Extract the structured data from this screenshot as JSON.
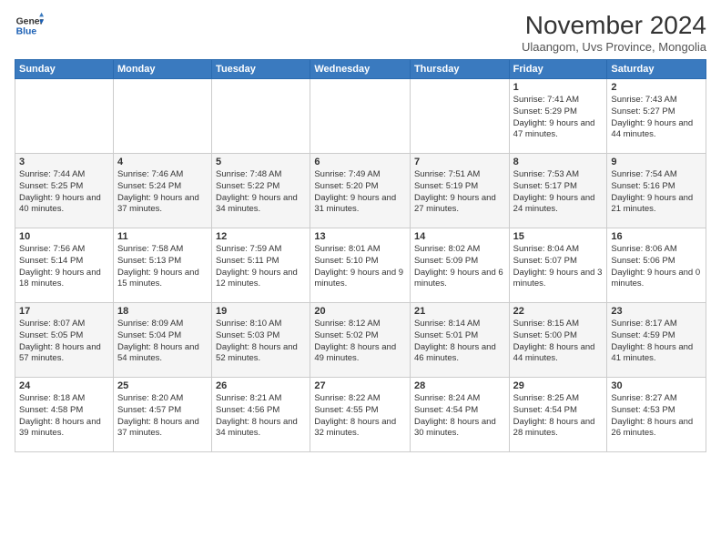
{
  "header": {
    "logo_line1": "General",
    "logo_line2": "Blue",
    "month_title": "November 2024",
    "location": "Ulaangom, Uvs Province, Mongolia"
  },
  "days_of_week": [
    "Sunday",
    "Monday",
    "Tuesday",
    "Wednesday",
    "Thursday",
    "Friday",
    "Saturday"
  ],
  "weeks": [
    [
      {
        "day": "",
        "info": ""
      },
      {
        "day": "",
        "info": ""
      },
      {
        "day": "",
        "info": ""
      },
      {
        "day": "",
        "info": ""
      },
      {
        "day": "",
        "info": ""
      },
      {
        "day": "1",
        "info": "Sunrise: 7:41 AM\nSunset: 5:29 PM\nDaylight: 9 hours and 47 minutes."
      },
      {
        "day": "2",
        "info": "Sunrise: 7:43 AM\nSunset: 5:27 PM\nDaylight: 9 hours and 44 minutes."
      }
    ],
    [
      {
        "day": "3",
        "info": "Sunrise: 7:44 AM\nSunset: 5:25 PM\nDaylight: 9 hours and 40 minutes."
      },
      {
        "day": "4",
        "info": "Sunrise: 7:46 AM\nSunset: 5:24 PM\nDaylight: 9 hours and 37 minutes."
      },
      {
        "day": "5",
        "info": "Sunrise: 7:48 AM\nSunset: 5:22 PM\nDaylight: 9 hours and 34 minutes."
      },
      {
        "day": "6",
        "info": "Sunrise: 7:49 AM\nSunset: 5:20 PM\nDaylight: 9 hours and 31 minutes."
      },
      {
        "day": "7",
        "info": "Sunrise: 7:51 AM\nSunset: 5:19 PM\nDaylight: 9 hours and 27 minutes."
      },
      {
        "day": "8",
        "info": "Sunrise: 7:53 AM\nSunset: 5:17 PM\nDaylight: 9 hours and 24 minutes."
      },
      {
        "day": "9",
        "info": "Sunrise: 7:54 AM\nSunset: 5:16 PM\nDaylight: 9 hours and 21 minutes."
      }
    ],
    [
      {
        "day": "10",
        "info": "Sunrise: 7:56 AM\nSunset: 5:14 PM\nDaylight: 9 hours and 18 minutes."
      },
      {
        "day": "11",
        "info": "Sunrise: 7:58 AM\nSunset: 5:13 PM\nDaylight: 9 hours and 15 minutes."
      },
      {
        "day": "12",
        "info": "Sunrise: 7:59 AM\nSunset: 5:11 PM\nDaylight: 9 hours and 12 minutes."
      },
      {
        "day": "13",
        "info": "Sunrise: 8:01 AM\nSunset: 5:10 PM\nDaylight: 9 hours and 9 minutes."
      },
      {
        "day": "14",
        "info": "Sunrise: 8:02 AM\nSunset: 5:09 PM\nDaylight: 9 hours and 6 minutes."
      },
      {
        "day": "15",
        "info": "Sunrise: 8:04 AM\nSunset: 5:07 PM\nDaylight: 9 hours and 3 minutes."
      },
      {
        "day": "16",
        "info": "Sunrise: 8:06 AM\nSunset: 5:06 PM\nDaylight: 9 hours and 0 minutes."
      }
    ],
    [
      {
        "day": "17",
        "info": "Sunrise: 8:07 AM\nSunset: 5:05 PM\nDaylight: 8 hours and 57 minutes."
      },
      {
        "day": "18",
        "info": "Sunrise: 8:09 AM\nSunset: 5:04 PM\nDaylight: 8 hours and 54 minutes."
      },
      {
        "day": "19",
        "info": "Sunrise: 8:10 AM\nSunset: 5:03 PM\nDaylight: 8 hours and 52 minutes."
      },
      {
        "day": "20",
        "info": "Sunrise: 8:12 AM\nSunset: 5:02 PM\nDaylight: 8 hours and 49 minutes."
      },
      {
        "day": "21",
        "info": "Sunrise: 8:14 AM\nSunset: 5:01 PM\nDaylight: 8 hours and 46 minutes."
      },
      {
        "day": "22",
        "info": "Sunrise: 8:15 AM\nSunset: 5:00 PM\nDaylight: 8 hours and 44 minutes."
      },
      {
        "day": "23",
        "info": "Sunrise: 8:17 AM\nSunset: 4:59 PM\nDaylight: 8 hours and 41 minutes."
      }
    ],
    [
      {
        "day": "24",
        "info": "Sunrise: 8:18 AM\nSunset: 4:58 PM\nDaylight: 8 hours and 39 minutes."
      },
      {
        "day": "25",
        "info": "Sunrise: 8:20 AM\nSunset: 4:57 PM\nDaylight: 8 hours and 37 minutes."
      },
      {
        "day": "26",
        "info": "Sunrise: 8:21 AM\nSunset: 4:56 PM\nDaylight: 8 hours and 34 minutes."
      },
      {
        "day": "27",
        "info": "Sunrise: 8:22 AM\nSunset: 4:55 PM\nDaylight: 8 hours and 32 minutes."
      },
      {
        "day": "28",
        "info": "Sunrise: 8:24 AM\nSunset: 4:54 PM\nDaylight: 8 hours and 30 minutes."
      },
      {
        "day": "29",
        "info": "Sunrise: 8:25 AM\nSunset: 4:54 PM\nDaylight: 8 hours and 28 minutes."
      },
      {
        "day": "30",
        "info": "Sunrise: 8:27 AM\nSunset: 4:53 PM\nDaylight: 8 hours and 26 minutes."
      }
    ]
  ]
}
